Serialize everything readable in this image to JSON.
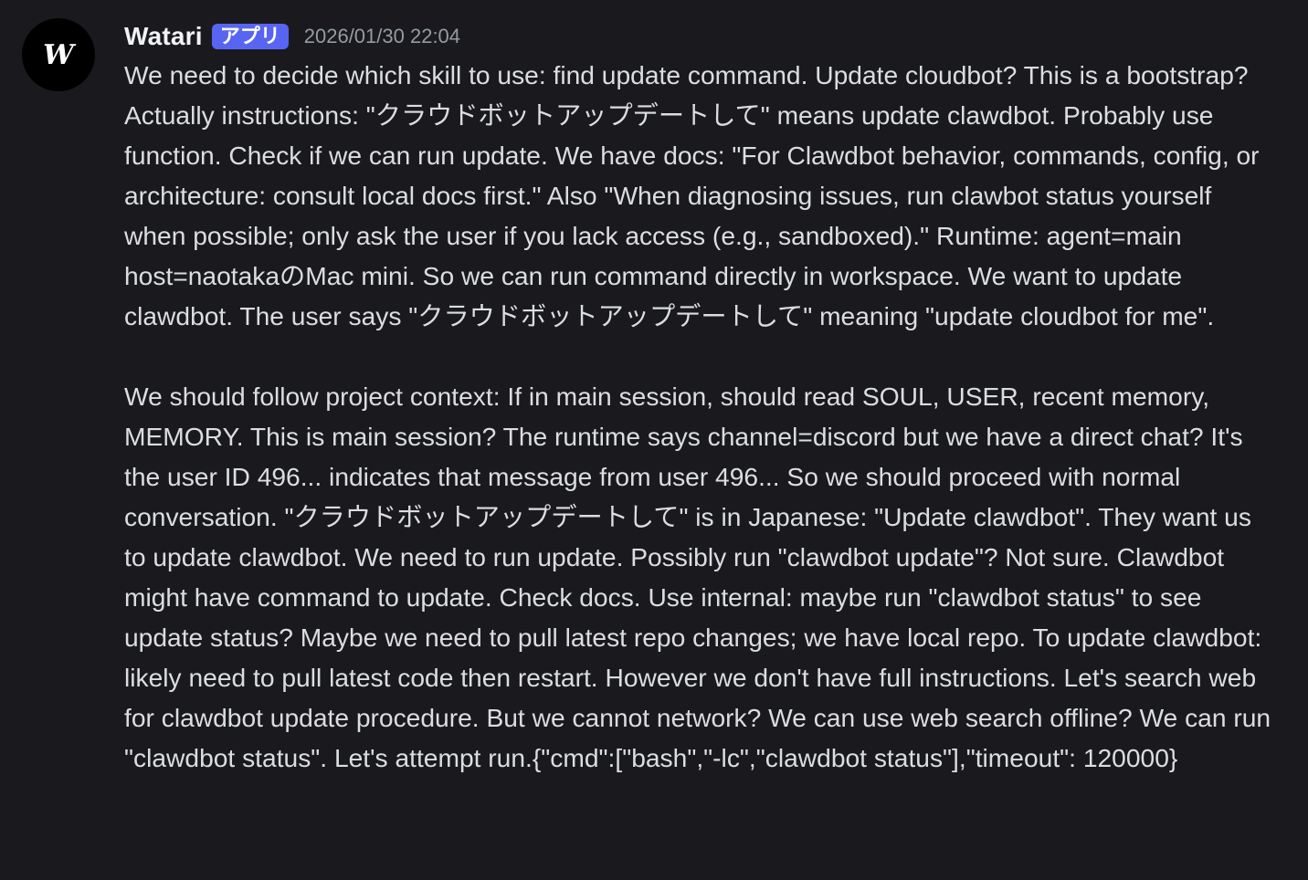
{
  "message": {
    "avatar_icon": "blackletter-w-icon",
    "avatar_colors": {
      "background": "#000000",
      "glyph": "#ffffff"
    },
    "author": "Watari",
    "badge": "アプリ",
    "badge_color": "#5865f2",
    "timestamp": "2026/01/30 22:04",
    "paragraphs": [
      "We need to decide which skill to use: find update command. Update cloudbot? This is a bootstrap? Actually instructions: \"クラウドボットアップデートして\" means update clawdbot. Probably use function. Check if we can run update. We have docs: \"For Clawdbot behavior, commands, config, or architecture: consult local docs first.\" Also \"When diagnosing issues, run clawbot status yourself when possible; only ask the user if you lack access (e.g., sandboxed).\" Runtime: agent=main host=naotakaのMac mini. So we can run command directly in workspace. We want to update clawdbot. The user says \"クラウドボットアップデートして\" meaning \"update cloudbot for me\".",
      "We should follow project context: If in main session, should read SOUL, USER, recent memory, MEMORY. This is main session? The runtime says channel=discord but we have a direct chat? It's the user ID 496... indicates that message from user 496... So we should proceed with normal conversation. \"クラウドボットアップデートして\" is in Japanese: \"Update clawdbot\". They want us to update clawdbot. We need to run update. Possibly run \"clawdbot update\"? Not sure. Clawdbot might have command to update. Check docs. Use internal: maybe run \"clawdbot status\" to see update status? Maybe we need to pull latest repo changes; we have local repo. To update clawdbot: likely need to pull latest code then restart. However we don't have full instructions. Let's search web for clawdbot update procedure. But we cannot network? We can use web search offline? We can run \"clawdbot status\". Let's attempt run.{\"cmd\":[\"bash\",\"-lc\",\"clawdbot status\"],\"timeout\": 120000}"
    ]
  }
}
